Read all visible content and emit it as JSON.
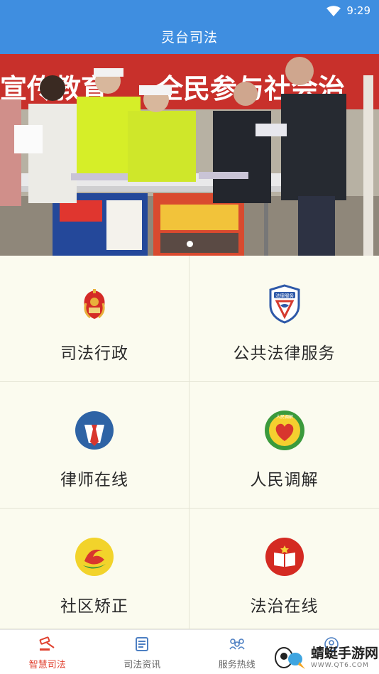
{
  "status": {
    "time": "9:29"
  },
  "app": {
    "title": "灵台司法"
  },
  "banner": {
    "description_text_left": "宣传教育",
    "description_text_right": "全民参与社会治",
    "slides": 1,
    "active_slide": 0
  },
  "grid": [
    {
      "label": "司法行政",
      "icon": "emblem-icon"
    },
    {
      "label": "公共法律服务",
      "icon": "legal-service-shield-icon",
      "icon_text": "法律服务"
    },
    {
      "label": "律师在线",
      "icon": "lawyer-tie-icon"
    },
    {
      "label": "人民调解",
      "icon": "mediation-heart-icon",
      "icon_text": "人民调解"
    },
    {
      "label": "社区矫正",
      "icon": "community-correction-icon"
    },
    {
      "label": "法治在线",
      "icon": "law-book-icon"
    }
  ],
  "tabs": [
    {
      "label": "智慧司法",
      "active": true
    },
    {
      "label": "司法资讯",
      "active": false
    },
    {
      "label": "服务热线",
      "active": false
    },
    {
      "label": "",
      "active": false
    }
  ],
  "watermark": {
    "name": "蜻蜓手游网",
    "url": "WWW.QT6.COM"
  },
  "colors": {
    "appbar": "#3f8ee0",
    "active_tab": "#e0412f",
    "grid_bg": "#fbfbef"
  }
}
